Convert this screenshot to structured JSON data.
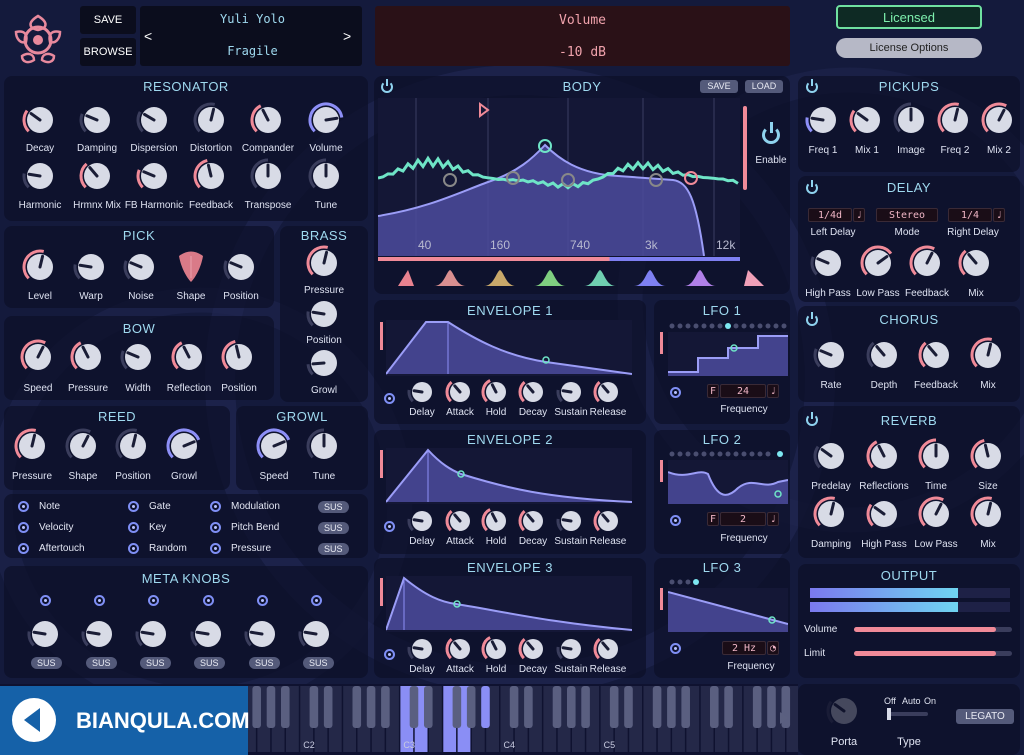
{
  "colors": {
    "accent_pink": "#f08a98",
    "accent_blue": "#8d8ff7",
    "title_cyan": "#9fd9ef",
    "panel_bg": "#0c0f28"
  },
  "header": {
    "save": "SAVE",
    "browse": "BROWSE",
    "author": "Yuli Yolo",
    "preset": "Fragile",
    "prev": "<",
    "next": ">",
    "param_name": "Volume",
    "param_value": "-10 dB",
    "licensed": "Licensed",
    "license_options": "License Options",
    "logo": "rose-logo-icon"
  },
  "resonator": {
    "title": "RESONATOR",
    "row1": [
      "Decay",
      "Damping",
      "Dispersion",
      "Distortion",
      "Compander",
      "Volume"
    ],
    "row2": [
      "Harmonic",
      "Hrmnx Mix",
      "FB Harmonic",
      "Feedback",
      "Transpose",
      "Tune"
    ]
  },
  "pick": {
    "title": "PICK",
    "labels": [
      "Level",
      "Warp",
      "Noise",
      "Shape",
      "Position"
    ]
  },
  "brass": {
    "title": "BRASS",
    "labels": [
      "Pressure",
      "Position",
      "Growl"
    ]
  },
  "bow": {
    "title": "BOW",
    "labels": [
      "Speed",
      "Pressure",
      "Width",
      "Reflection",
      "Position"
    ]
  },
  "reed": {
    "title": "REED",
    "labels": [
      "Pressure",
      "Shape",
      "Position",
      "Growl"
    ]
  },
  "growl": {
    "title": "GROWL",
    "labels": [
      "Speed",
      "Tune"
    ]
  },
  "modsources": {
    "col1": [
      "Note",
      "Velocity",
      "Aftertouch"
    ],
    "col2": [
      "Gate",
      "Key",
      "Random"
    ],
    "col3": [
      "Modulation",
      "Pitch Bend",
      "Pressure"
    ],
    "sus": "SUS"
  },
  "meta": {
    "title": "META KNOBS",
    "sus": "SUS"
  },
  "body": {
    "title": "BODY",
    "save": "SAVE",
    "load": "LOAD",
    "enable": "Enable",
    "freq_labels": [
      "40",
      "160",
      "740",
      "3k",
      "12k"
    ]
  },
  "envelopes": [
    {
      "title": "ENVELOPE 1"
    },
    {
      "title": "ENVELOPE 2"
    },
    {
      "title": "ENVELOPE 3"
    }
  ],
  "env_labels": [
    "Delay",
    "Attack",
    "Hold",
    "Decay",
    "Sustain",
    "Release"
  ],
  "lfos": [
    {
      "title": "LFO 1",
      "mode": "F",
      "value": "24",
      "freq_label": "Frequency"
    },
    {
      "title": "LFO 2",
      "mode": "F",
      "value": "2",
      "freq_label": "Frequency"
    },
    {
      "title": "LFO 3",
      "mode": "",
      "value": "2 Hz",
      "freq_label": "Frequency"
    }
  ],
  "pickups": {
    "title": "PICKUPS",
    "labels": [
      "Freq 1",
      "Mix 1",
      "Image",
      "Freq 2",
      "Mix 2"
    ]
  },
  "delay": {
    "title": "DELAY",
    "left_value": "1/4d",
    "mode_value": "Stereo",
    "right_value": "1/4",
    "left_label": "Left Delay",
    "mode_label": "Mode",
    "right_label": "Right Delay",
    "knob_labels": [
      "High Pass",
      "Low Pass",
      "Feedback",
      "Mix"
    ]
  },
  "chorus": {
    "title": "CHORUS",
    "labels": [
      "Rate",
      "Depth",
      "Feedback",
      "Mix"
    ]
  },
  "reverb": {
    "title": "REVERB",
    "row1": [
      "Predelay",
      "Reflections",
      "Time",
      "Size"
    ],
    "row2": [
      "Damping",
      "High Pass",
      "Low Pass",
      "Mix"
    ]
  },
  "output": {
    "title": "OUTPUT",
    "volume_label": "Volume",
    "limit_label": "Limit",
    "volume_level": 0.9,
    "limit_level": 0.9
  },
  "keyboard": {
    "octaves": [
      "C2",
      "C3",
      "C4",
      "C5"
    ]
  },
  "bottom": {
    "porta": "Porta",
    "type": "Type",
    "type_options": [
      "Off",
      "Auto",
      "On"
    ],
    "legato": "LEGATO"
  },
  "watermark": "BIANQULA.COM"
}
